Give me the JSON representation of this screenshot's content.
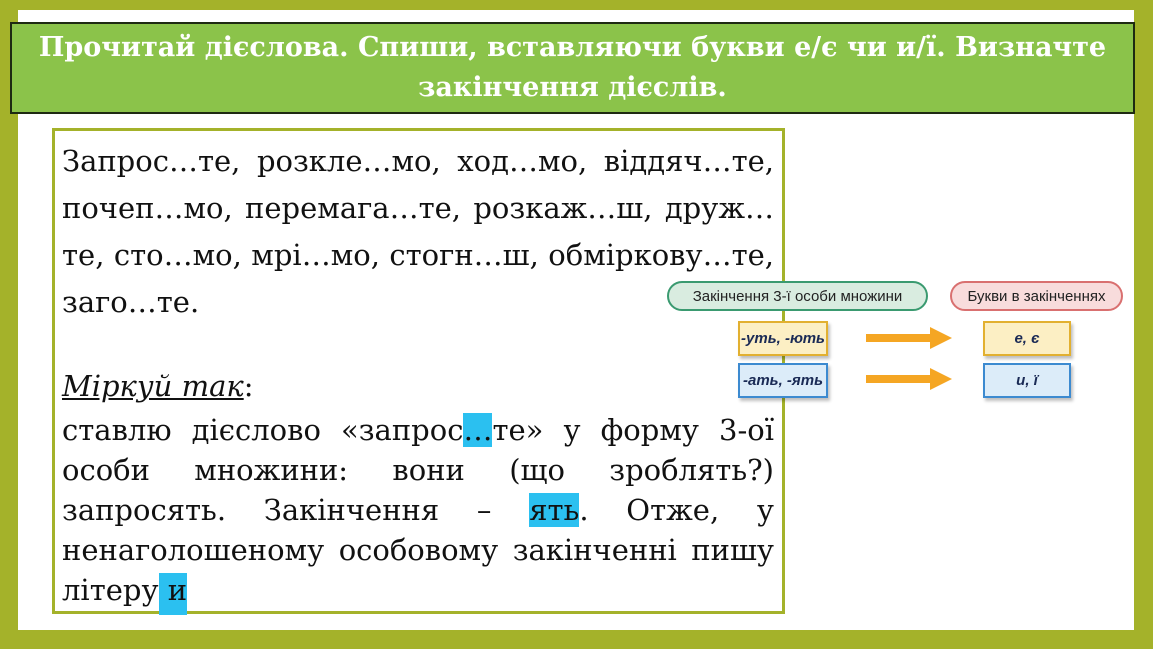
{
  "title": "Прочитай дієслова. Спиши, вставляючи букви е/є чи и/ї. Визначте закінчення дієслів.",
  "exercise": {
    "verbs_text": "Запрос…те, розкле…мо, ход…мо, віддяч…те, почеп…мо, перемага…те, розкаж…ш, друж…те, сто…мо, мрі…мо, стогн…ш, обміркову…те, заго…те."
  },
  "hint": {
    "heading": "Міркуй так",
    "colon": ":",
    "line_before_verb": "ставлю дієслово «запрос",
    "verb_gap": "…",
    "line_after_verb": "те» у форму 3-ої особи множини: вони (що зроблять?) запросять. Закінчення – ",
    "ending": "ять",
    "line_after_ending": ". Отже, у ненаголошеному особовому закінченні пишу літеру",
    "letter": " и"
  },
  "diagram": {
    "header_left": "Закінчення 3-ї особи множини",
    "header_right": "Букви в закінченнях",
    "endings": [
      "-уть, -ють",
      "-ать, -ять"
    ],
    "letters": [
      "е, є",
      "и, ї"
    ]
  },
  "colors": {
    "frame": "#a4b22a",
    "title_bg": "#8bc34a",
    "highlight": "#2bc0f0",
    "arrow": "#f5a623"
  }
}
